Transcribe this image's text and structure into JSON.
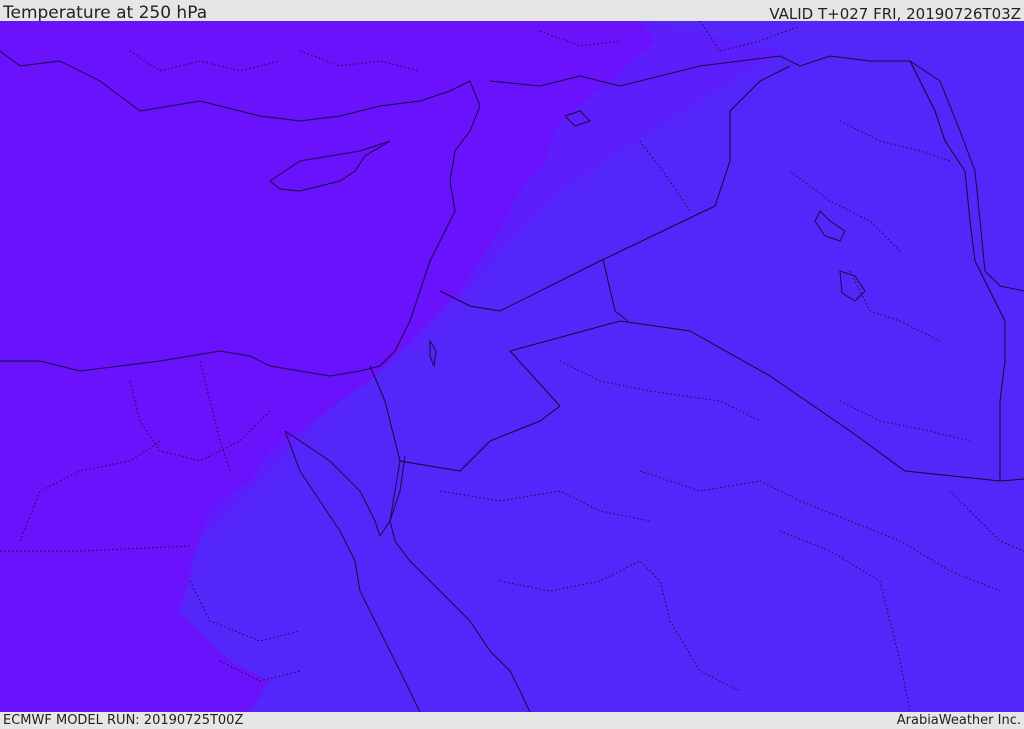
{
  "header": {
    "title": "Temperature at 250 hPa",
    "valid": "VALID T+027 FRI, 20190726T03Z"
  },
  "footer": {
    "model_run": "ECMWF MODEL RUN: 20190725T00Z",
    "credit": "ArabiaWeather Inc."
  },
  "map": {
    "variable": "Temperature",
    "level": "250 hPa",
    "colors": {
      "cold_field": "#6a12fc",
      "transition_field": "#5c1ffb",
      "mild_field": "#5426fa",
      "coastline": "#1a0a40",
      "border": "#14082f"
    }
  }
}
